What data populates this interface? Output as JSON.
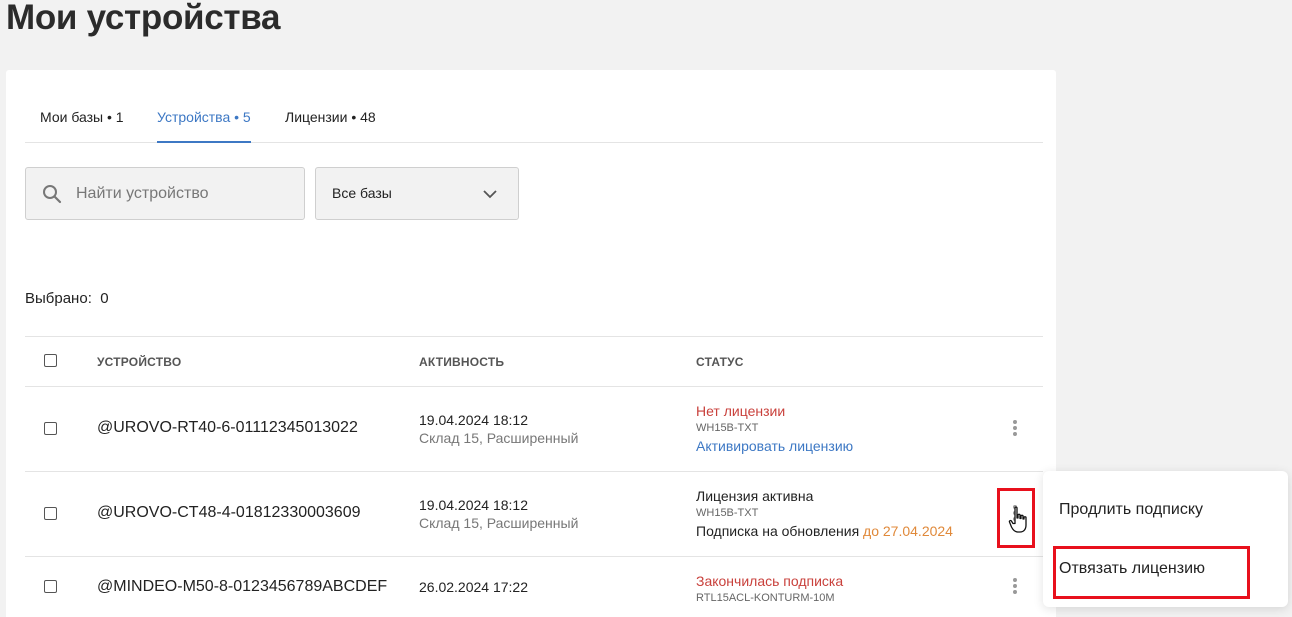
{
  "page": {
    "title": "Мои устройства"
  },
  "tabs": [
    {
      "label": "Мои базы • 1",
      "active": false
    },
    {
      "label": "Устройства • 5",
      "active": true
    },
    {
      "label": "Лицензии • 48",
      "active": false
    }
  ],
  "search": {
    "placeholder": "Найти устройство",
    "value": "",
    "icon": "search-icon"
  },
  "filter": {
    "value": "Все базы",
    "icon": "chevron-down-icon"
  },
  "selection": {
    "label": "Выбрано:",
    "count": "0"
  },
  "table": {
    "headers": {
      "device": "УСТРОЙСТВО",
      "activity": "АКТИВНОСТЬ",
      "status": "СТАТУС"
    },
    "rows": [
      {
        "device": "@UROVO-RT40-6-01112345013022",
        "activity_date": "19.04.2024 18:12",
        "activity_place": "Склад 15, Расширенный",
        "status": "Нет лицензии",
        "license_code": "WH15B-TXT",
        "action_link": "Активировать лицензию"
      },
      {
        "device": "@UROVO-CT48-4-01812330003609",
        "activity_date": "19.04.2024 18:12",
        "activity_place": "Склад 15, Расширенный",
        "status": "Лицензия активна",
        "license_code": "WH15B-TXT",
        "subscription_label": "Подписка на обновления",
        "subscription_until": "до 27.04.2024"
      },
      {
        "device": "@MINDEO-M50-8-0123456789ABCDEF",
        "activity_date": "26.02.2024 17:22",
        "status": "Закончилась подписка",
        "license_code": "RTL15ACL-KONTURM-10M"
      }
    ]
  },
  "context_menu": {
    "items": [
      {
        "label": "Продлить подписку"
      },
      {
        "label": "Отвязать лицензию"
      }
    ]
  },
  "colors": {
    "accent": "#3d78c4",
    "error": "#c9413c",
    "warning": "#e0893a",
    "highlight": "#e8101c"
  }
}
